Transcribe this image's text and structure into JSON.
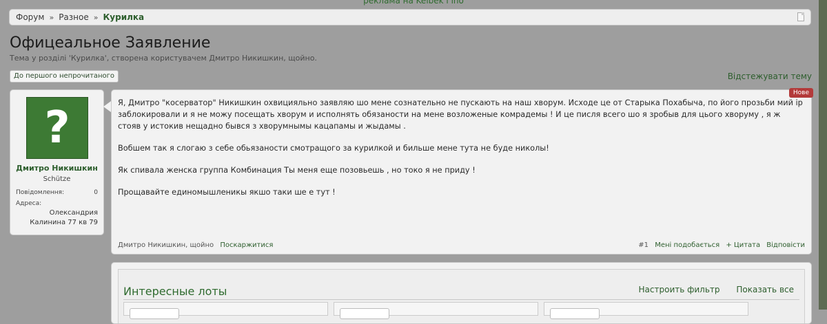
{
  "top_ad": "реклама на Kelbek i ino",
  "breadcrumb": {
    "items": [
      "Форум",
      "Разное",
      "Курилка"
    ],
    "separator": "»"
  },
  "page": {
    "title": "Офицеальное Заявление",
    "description": "Тема у розділі 'Курилка', створена користувачем Дмитро Никишкин, щойно.",
    "unread_button": "До першого непрочитаного",
    "watch_link": "Відстежувати тему"
  },
  "user": {
    "name": "Дмитро Никишкин",
    "title": "Schütze",
    "messages_label": "Повідомлення:",
    "messages_value": "0",
    "address_label": "Адреса:",
    "address_line1": "Олександрия",
    "address_line2": "Калинина 77 кв 79",
    "avatar_icon": "question-mark-icon"
  },
  "post": {
    "badge": "Нове",
    "paragraphs": [
      "Я, Дмитро \"косерватор\" Никишкин охвицияльно заявляю шо мене сознательно не пускають на наш хворум. Исходе це от Старыка Похабыча, по його прозьби мий ip заблокировали и я не можу посещать хворум и исполнять обязаности на мене возложеные комрадемы ! И це писля всего шо я зробыв для цього хворуму , я ж стояв у истокив нещадно бывся з хворумнымы кацапамы и жыдамы .",
      "Вобшем так я слогаю з себе обьязаности смотращого за курилкой и бильше мене тута не буде николы!",
      "Як спивала женска группа Комбинация Ты меня еще позовьешь , но токо я не приду !",
      "Прощавайте единомышленикы якшо таки ше е тут !"
    ],
    "footer": {
      "author_time": "Дмитро Никишкин, щойно",
      "report": "Поскаржитися",
      "number": "#1",
      "like": "Мені подобається",
      "quote": "+ Цитата",
      "reply": "Відповісти"
    }
  },
  "lots": {
    "title": "Интересные лоты",
    "filter_link": "Настроить фильтр",
    "show_all_link": "Показать все"
  },
  "colors": {
    "accent_green": "#2d5e2d",
    "badge_red": "#b33a3a",
    "avatar_green": "#3d7a34"
  }
}
